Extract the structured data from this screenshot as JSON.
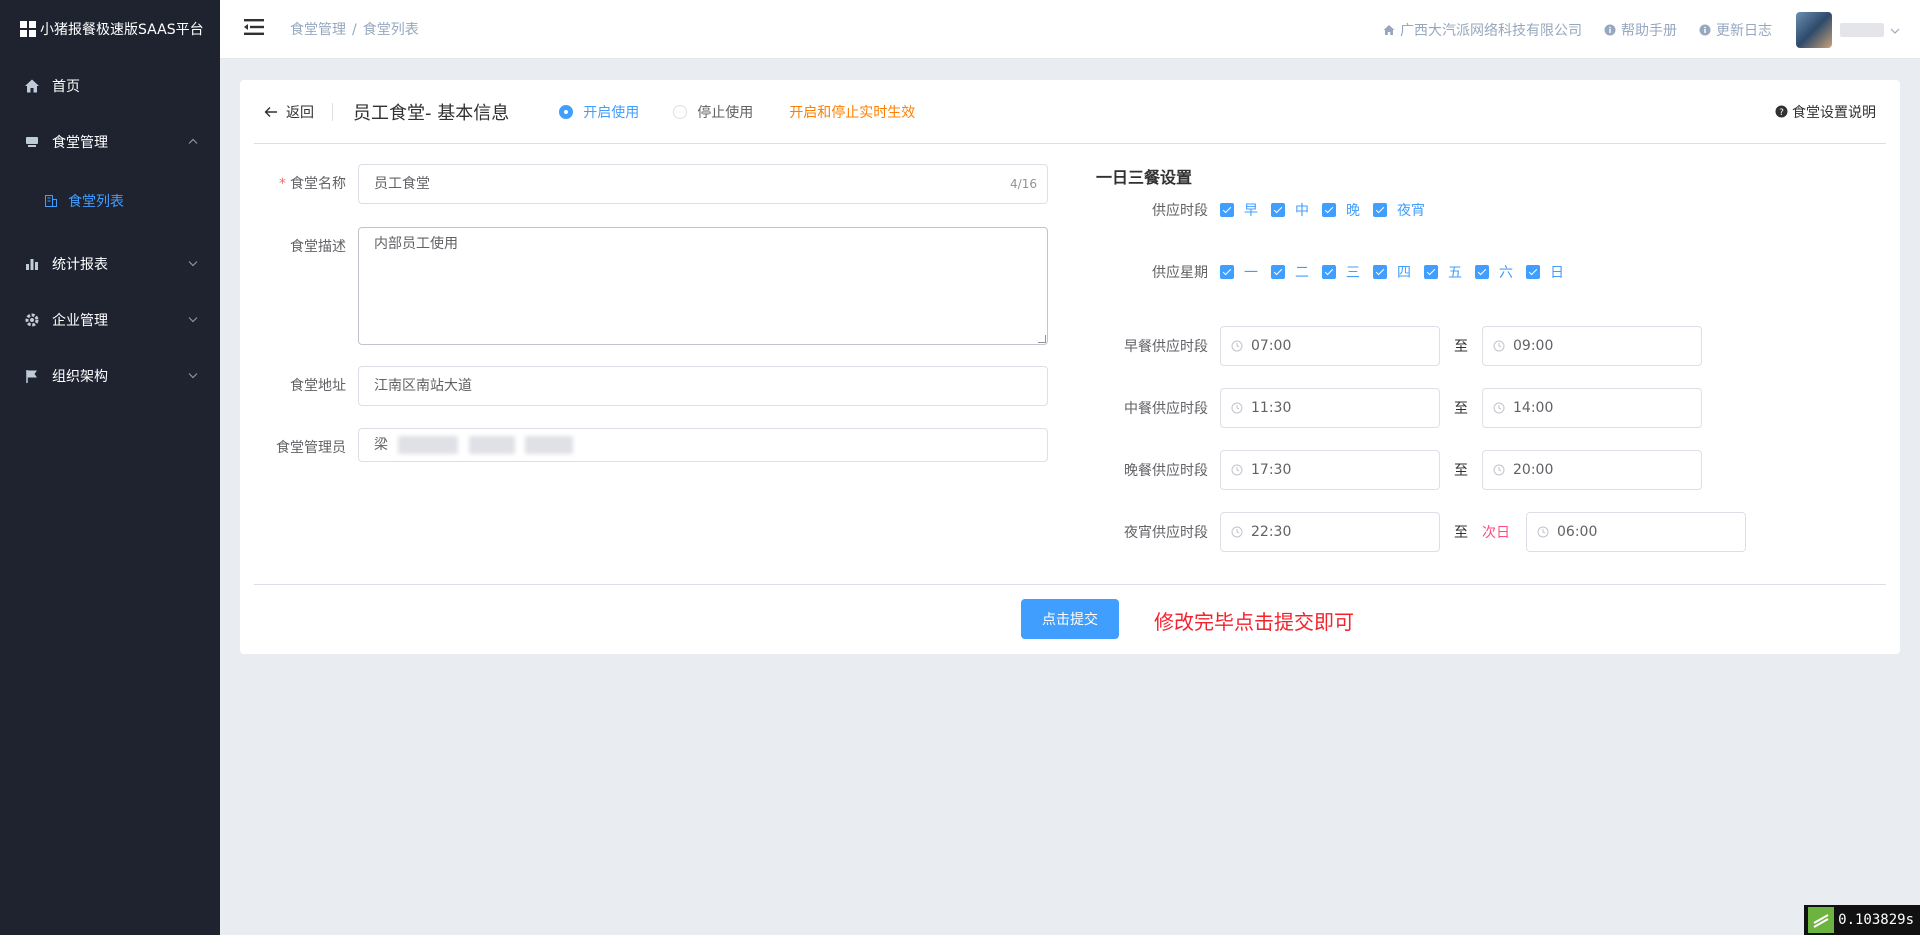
{
  "app": {
    "title": "小猪报餐极速版SAAS平台"
  },
  "sidebar": {
    "items": [
      {
        "label": "首页",
        "icon": "home-icon"
      },
      {
        "label": "食堂管理",
        "icon": "canteen-icon",
        "expanded": true
      },
      {
        "label": "统计报表",
        "icon": "bar-chart-icon"
      },
      {
        "label": "企业管理",
        "icon": "gear-icon"
      },
      {
        "label": "组织架构",
        "icon": "flag-icon"
      }
    ],
    "sub_item": {
      "label": "食堂列表",
      "icon": "building-icon"
    }
  },
  "header": {
    "breadcrumb": [
      "食堂管理",
      "食堂列表"
    ],
    "breadcrumb_sep": "/",
    "company": "广西大汽派网络科技有限公司",
    "help": "帮助手册",
    "changelog": "更新日志"
  },
  "card": {
    "back": "返回",
    "title": "员工食堂- 基本信息",
    "radio_on": "开启使用",
    "radio_off": "停止使用",
    "radio_hint": "开启和停止实时生效",
    "help": "食堂设置说明"
  },
  "form": {
    "name_label": "食堂名称",
    "name_value": "员工食堂",
    "name_count": "4/16",
    "desc_label": "食堂描述",
    "desc_value": "内部员工使用",
    "address_label": "食堂地址",
    "address_value": "江南区南站大道",
    "manager_label": "食堂管理员",
    "manager_value": "梁"
  },
  "meals": {
    "section_title": "一日三餐设置",
    "supply_time_label": "供应时段",
    "supply_times": [
      "早",
      "中",
      "晚",
      "夜宵"
    ],
    "supply_week_label": "供应星期",
    "weekdays": [
      "一",
      "二",
      "三",
      "四",
      "五",
      "六",
      "日"
    ],
    "to": "至",
    "next_day": "次日",
    "breakfast": {
      "label": "早餐供应时段",
      "start": "07:00",
      "end": "09:00"
    },
    "lunch": {
      "label": "中餐供应时段",
      "start": "11:30",
      "end": "14:00"
    },
    "dinner": {
      "label": "晚餐供应时段",
      "start": "17:30",
      "end": "20:00"
    },
    "late": {
      "label": "夜宵供应时段",
      "start": "22:30",
      "end": "06:00"
    }
  },
  "footer": {
    "submit": "点击提交",
    "hint": "修改完毕点击提交即可"
  },
  "timer": "0.103829s",
  "colors": {
    "sidebar_bg": "#1f2330",
    "accent": "#409eff",
    "warning": "#ff8000",
    "danger": "#f5222d",
    "next_day": "#ff4b7d"
  }
}
